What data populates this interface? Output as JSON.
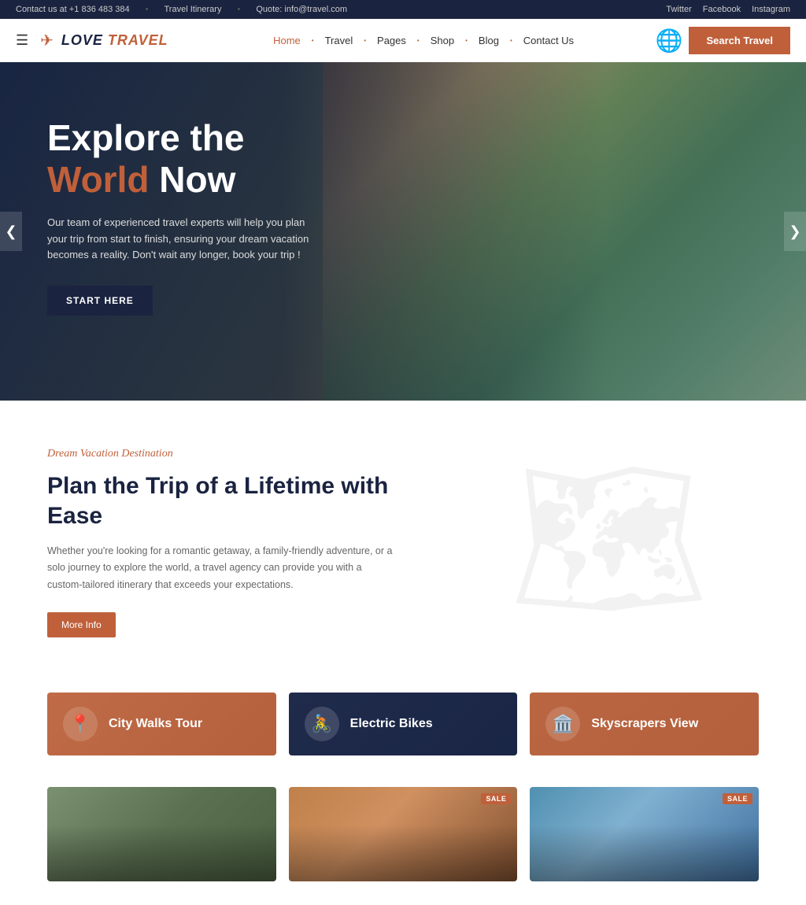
{
  "topbar": {
    "contact": "Contact us at +1 836 483 384",
    "travel": "Travel Itinerary",
    "quote": "Quote: info@travel.com",
    "twitter": "Twitter",
    "facebook": "Facebook",
    "instagram": "Instagram"
  },
  "header": {
    "logo": "Love Travel",
    "logo_accent": "Travel",
    "search_label": "Search Travel",
    "nav": [
      {
        "label": "Home",
        "active": true
      },
      {
        "label": "Travel"
      },
      {
        "label": "Pages"
      },
      {
        "label": "Shop"
      },
      {
        "label": "Blog"
      },
      {
        "label": "Contact Us"
      }
    ]
  },
  "hero": {
    "title_line1": "Explore the",
    "title_accent": "World",
    "title_line2": "Now",
    "description": "Our team of experienced travel experts will help you plan your trip from start to finish, ensuring your dream vacation becomes a reality. Don't wait any longer, book your trip !",
    "cta": "START HERE",
    "arrow_left": "❮",
    "arrow_right": "❯"
  },
  "dream": {
    "subtitle": "Dream Vacation Destination",
    "title": "Plan the Trip of a Lifetime with Ease",
    "description": "Whether you're looking for a romantic getaway, a family-friendly adventure, or a solo journey to explore the world, a travel agency can provide you with a custom-tailored itinerary that exceeds your expectations.",
    "more_info": "More Info"
  },
  "tour_cards": [
    {
      "id": "city-walks",
      "label": "City Walks Tour",
      "icon": "📍",
      "style": "orange"
    },
    {
      "id": "electric-bikes",
      "label": "Electric Bikes",
      "icon": "🚴",
      "style": "dark"
    },
    {
      "id": "skyscrapers",
      "label": "Skyscrapers View",
      "icon": "🏛️",
      "style": "orange2"
    }
  ],
  "gallery": [
    {
      "id": "gallery-1",
      "has_sale": false
    },
    {
      "id": "gallery-2",
      "has_sale": true,
      "sale_label": "SALE"
    },
    {
      "id": "gallery-3",
      "has_sale": true,
      "sale_label": "SALE"
    }
  ]
}
